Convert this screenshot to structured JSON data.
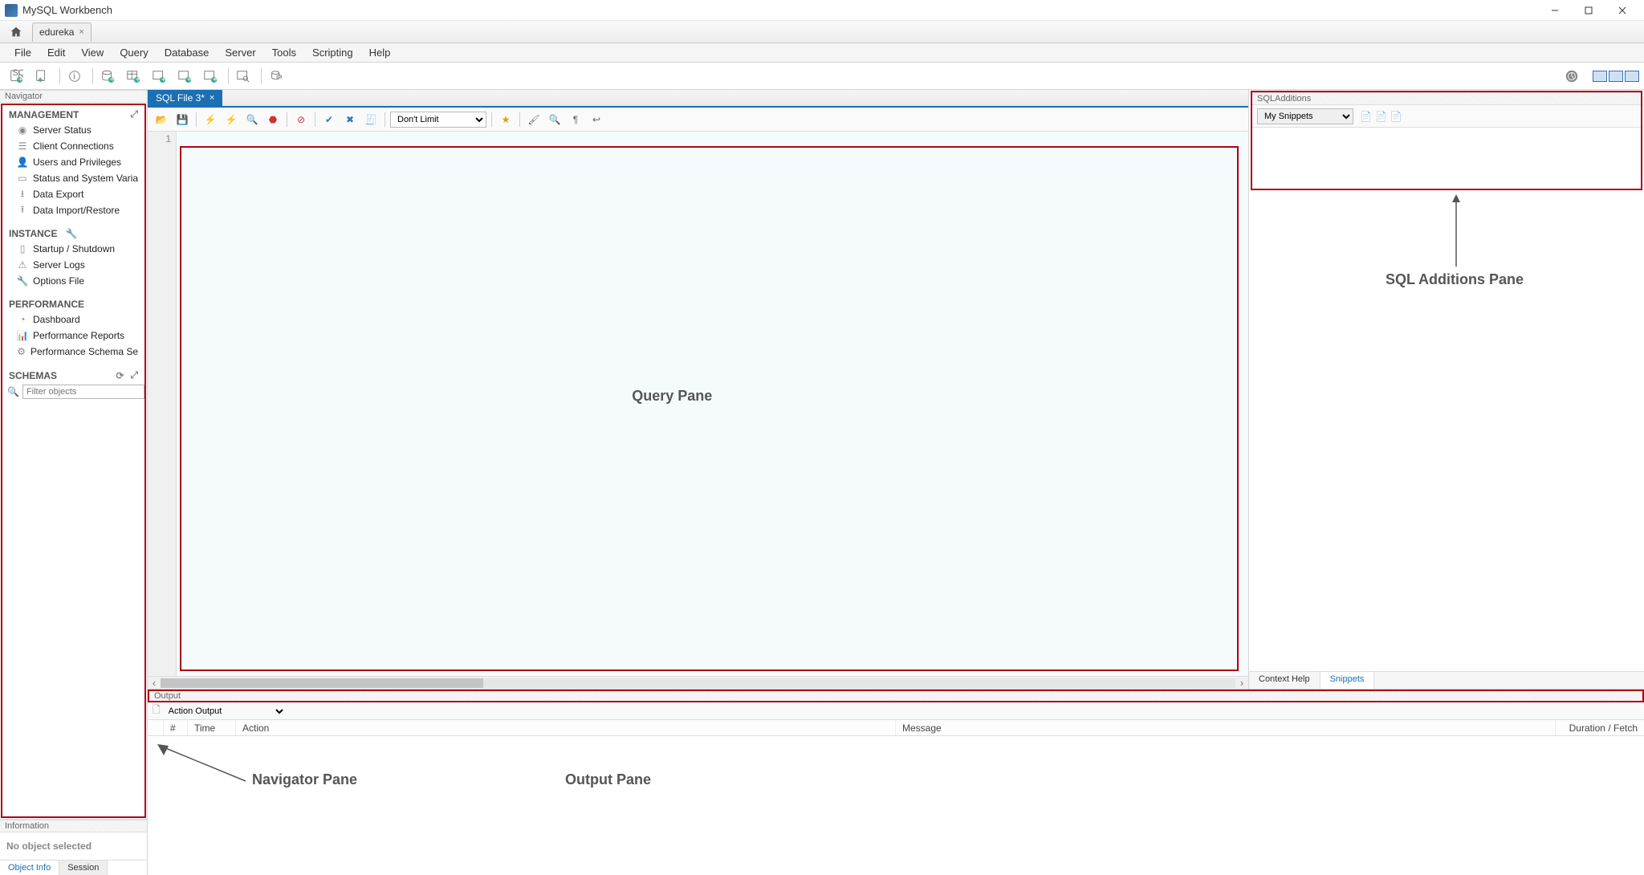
{
  "app_title": "MySQL Workbench",
  "connection_tab": "edureka",
  "menus": [
    "File",
    "Edit",
    "View",
    "Query",
    "Database",
    "Server",
    "Tools",
    "Scripting",
    "Help"
  ],
  "navigator": {
    "title": "Navigator",
    "sections": {
      "management": {
        "label": "MANAGEMENT",
        "items": [
          "Server Status",
          "Client Connections",
          "Users and Privileges",
          "Status and System Varia",
          "Data Export",
          "Data Import/Restore"
        ]
      },
      "instance": {
        "label": "INSTANCE",
        "items": [
          "Startup / Shutdown",
          "Server Logs",
          "Options File"
        ]
      },
      "performance": {
        "label": "PERFORMANCE",
        "items": [
          "Dashboard",
          "Performance Reports",
          "Performance Schema Se"
        ]
      },
      "schemas": {
        "label": "SCHEMAS"
      }
    },
    "filter_placeholder": "Filter objects"
  },
  "information": {
    "title": "Information",
    "body": "No object selected",
    "tabs": [
      "Object Info",
      "Session"
    ],
    "active_tab": 0
  },
  "sql_tab": {
    "label": "SQL File 3*"
  },
  "query_toolbar": {
    "limit_select": "Don't Limit"
  },
  "editor": {
    "line1": "1"
  },
  "sql_additions": {
    "title": "SQLAdditions",
    "snippets_select": "My Snippets",
    "bottom_tabs": [
      "Context Help",
      "Snippets"
    ],
    "active_bottom_tab": 1
  },
  "output": {
    "title": "Output",
    "select": "Action Output",
    "cols": {
      "hash": "#",
      "time": "Time",
      "action": "Action",
      "message": "Message",
      "duration": "Duration / Fetch"
    }
  },
  "annotations": {
    "query_pane": "Query Pane",
    "sql_add_pane": "SQL Additions Pane",
    "navigator_pane": "Navigator Pane",
    "output_pane": "Output Pane"
  }
}
